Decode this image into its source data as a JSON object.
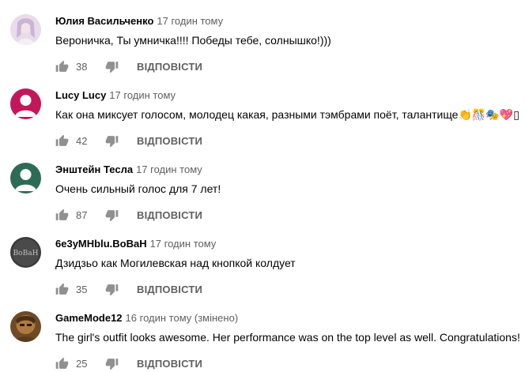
{
  "actions": {
    "reply_label": "ВІДПОВІСТИ"
  },
  "comments": [
    {
      "author": "Юлия Васильченко",
      "time": "17 годин тому",
      "text": "Вероничка, Ты умничка!!!! Победы тебе, солнышко!)))",
      "likes": "38",
      "avatar_color": "#d8c6e0"
    },
    {
      "author": "Lucy Lucy",
      "time": "17 годин тому",
      "text": "Как она миксует голосом, молодец какая, разными тэмбрами поёт, талантище👏🎊🎭💖▯",
      "likes": "42",
      "avatar_color": "#c2185b"
    },
    {
      "author": "Энштейн Тесла",
      "time": "17 годин тому",
      "text": "Очень сильный голос для 7 лет!",
      "likes": "87",
      "avatar_color": "#2e6b56"
    },
    {
      "author": "6e3yMHblu.BoBaH",
      "time": "17 годин тому",
      "text": "Дзидзьо как Могилевская над кнопкой колдует",
      "likes": "35",
      "avatar_color": "#3a3a3a",
      "avatar_text": "BoBaH"
    },
    {
      "author": "GameMode12",
      "time": "16 годин тому (змінено)",
      "text": "The girl's outfit looks awesome. Her performance was on the top level as well. Congratulations!",
      "likes": "25",
      "avatar_color": "#8a5a2b"
    }
  ]
}
